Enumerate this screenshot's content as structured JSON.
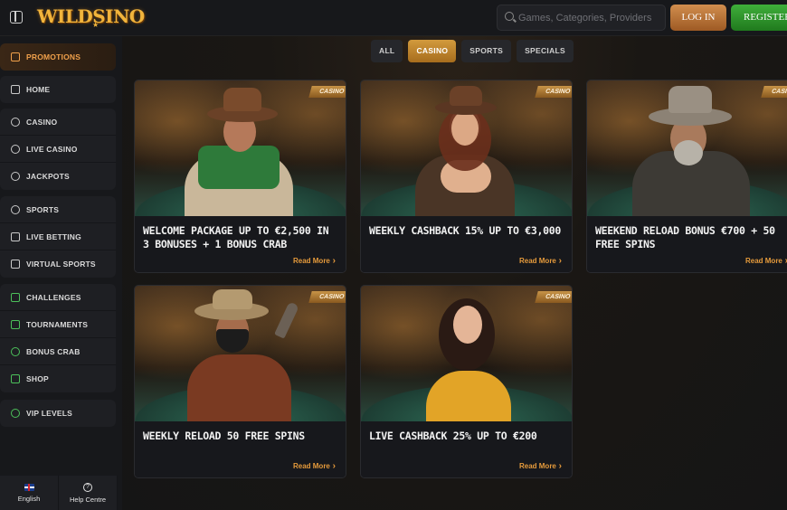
{
  "header": {
    "logo": "WILDSINO",
    "logo_star": "★",
    "search_placeholder": "Games, Categories, Providers",
    "login_label": "LOG IN",
    "register_label": "REGISTER"
  },
  "sidebar": {
    "promotions": "PROMOTIONS",
    "group1": [
      "HOME"
    ],
    "group2": [
      "CASINO",
      "LIVE CASINO",
      "JACKPOTS"
    ],
    "group3": [
      "SPORTS",
      "LIVE BETTING",
      "VIRTUAL SPORTS"
    ],
    "group4": [
      "CHALLENGES",
      "TOURNAMENTS",
      "BONUS CRAB",
      "SHOP"
    ],
    "group5": [
      "VIP LEVELS"
    ],
    "bottom": {
      "language": "English",
      "help": "Help Centre"
    }
  },
  "tabs": [
    {
      "label": "ALL",
      "active": false
    },
    {
      "label": "CASINO",
      "active": true
    },
    {
      "label": "SPORTS",
      "active": false
    },
    {
      "label": "SPECIALS",
      "active": false
    }
  ],
  "cards": [
    {
      "badge": "CASINO",
      "title": "Welcome Package up to €2,500 in 3 bonuses + 1 Bonus Crab",
      "link": "Read More"
    },
    {
      "badge": "CASINO",
      "title": "Weekly Cashback 15% up to €3,000",
      "link": "Read More"
    },
    {
      "badge": "CASINO",
      "title": "Weekend Reload Bonus €700 + 50 Free Spins",
      "link": "Read More"
    },
    {
      "badge": "CASINO",
      "title": "Weekly Reload 50 Free Spins",
      "link": "Read More"
    },
    {
      "badge": "CASINO",
      "title": "Live Cashback 25% up to €200",
      "link": "Read More"
    }
  ],
  "colors": {
    "accent": "#e59a3b",
    "login": "#c07a3a",
    "register": "#2f9a2c",
    "background": "#131417"
  }
}
